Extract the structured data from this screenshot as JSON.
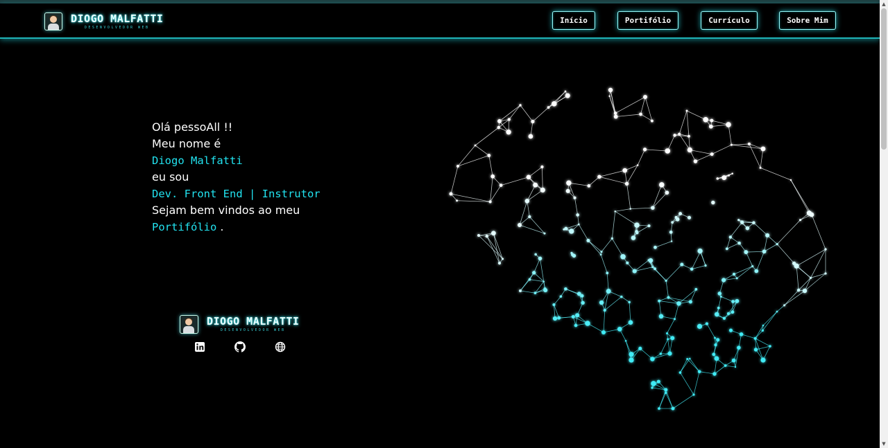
{
  "header": {
    "brand_name": "DIOGO MALFATTI",
    "brand_subtitle": "DESENVOLVEDOR WEB",
    "nav": [
      {
        "label": "Início"
      },
      {
        "label": "Portifólio"
      },
      {
        "label": "Currículo"
      },
      {
        "label": "Sobre Mim"
      }
    ]
  },
  "intro": {
    "line1": "Olá pessoAll !!",
    "line2": "Meu nome é",
    "name": "Diogo Malfatti",
    "line4": "eu sou",
    "role": "Dev. Front End | Instrutor",
    "line6": "Sejam bem vindos ao meu",
    "portfolio_link": "Portifólio",
    "period": " ."
  },
  "footer": {
    "brand_name": "DIOGO MALFATTI",
    "brand_subtitle": "DESENVOLVEDOR WEB",
    "socials": [
      "linkedin-icon",
      "github-icon",
      "globe-icon"
    ]
  },
  "colors": {
    "accent": "#22e3f0",
    "background": "#000000",
    "header_border": "#1fb5b8"
  }
}
